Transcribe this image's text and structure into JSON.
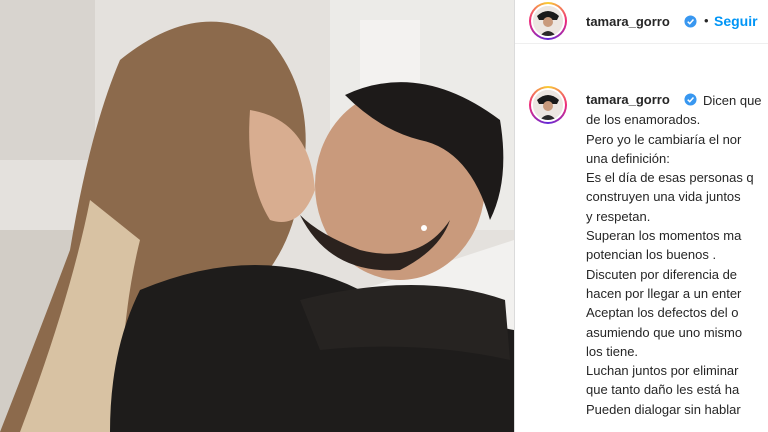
{
  "post": {
    "username": "tamara_gorro",
    "follow_label": "Seguir",
    "separator": "•",
    "verified_icon": "verified-badge-icon",
    "caption_lines": [
      "Dicen que",
      "de los enamorados.",
      "Pero yo le cambiaría el nor",
      "una definición:",
      "Es el día de esas personas q",
      "construyen una vida juntos",
      "y respetan.",
      "Superan los momentos ma",
      "potencian los buenos .",
      "Discuten por diferencia de",
      "hacen por llegar a un enter",
      "Aceptan los defectos del o",
      "asumiendo que uno mismo",
      "los tiene.",
      "Luchan juntos por eliminar",
      "que tanto daño les está ha",
      "Pueden dialogar sin hablar"
    ]
  },
  "colors": {
    "link_blue": "#0095f6",
    "verified_blue": "#3897f0",
    "text": "#262626"
  }
}
